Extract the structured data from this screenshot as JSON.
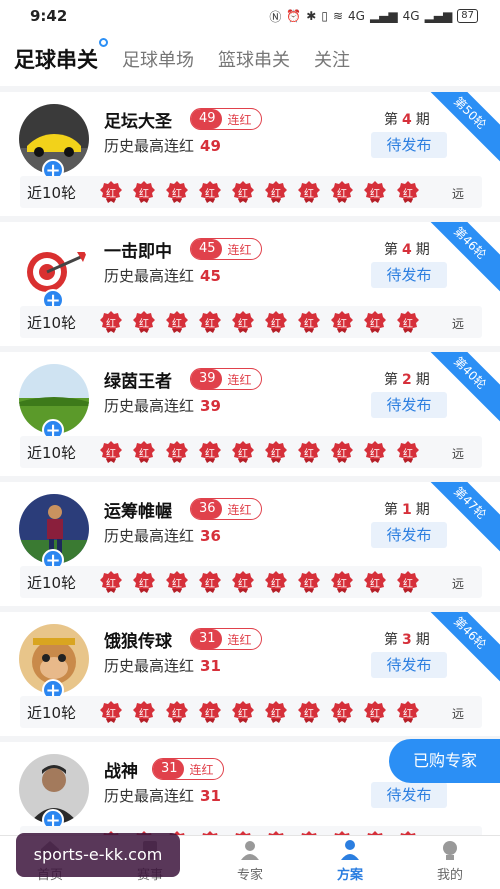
{
  "status": {
    "time": "9:42",
    "signal1": "4G",
    "signal2": "4G",
    "battery": "87"
  },
  "tabs": [
    {
      "label": "足球串关"
    },
    {
      "label": "足球单场"
    },
    {
      "label": "篮球串关"
    },
    {
      "label": "关注"
    }
  ],
  "recent_label": "近10轮",
  "more_label": "远",
  "period_prefix": "第",
  "period_suffix": "期",
  "pending_label": "待发布",
  "hist_label": "历史最高连红",
  "streak_label": "连红",
  "badge_text": "红",
  "experts": [
    {
      "name": "足坛大圣",
      "streak": "49",
      "history": "49",
      "period": "4",
      "ribbon": "第50轮",
      "avatar_icon": "sports-car-icon"
    },
    {
      "name": "一击即中",
      "streak": "45",
      "history": "45",
      "period": "4",
      "ribbon": "第46轮",
      "avatar_icon": "dartboard-icon"
    },
    {
      "name": "绿茵王者",
      "streak": "39",
      "history": "39",
      "period": "2",
      "ribbon": "第40轮",
      "avatar_icon": "grass-field-icon"
    },
    {
      "name": "运筹帷幄",
      "streak": "36",
      "history": "36",
      "period": "1",
      "ribbon": "第47轮",
      "avatar_icon": "footballer-icon"
    },
    {
      "name": "饿狼传球",
      "streak": "31",
      "history": "31",
      "period": "3",
      "ribbon": "第46轮",
      "avatar_icon": "monkey-king-icon"
    },
    {
      "name": "战神",
      "streak": "31",
      "history": "31",
      "period": "",
      "ribbon": "",
      "avatar_icon": "man-portrait-icon"
    }
  ],
  "float_button": "已购专家",
  "bottom_nav": [
    {
      "label": "首页"
    },
    {
      "label": "赛事"
    },
    {
      "label": "专家"
    },
    {
      "label": "方案"
    },
    {
      "label": "我的"
    }
  ],
  "watermark": "sports-e-kk.com",
  "colors": {
    "accent": "#2b8ff5",
    "red": "#e0414b"
  }
}
